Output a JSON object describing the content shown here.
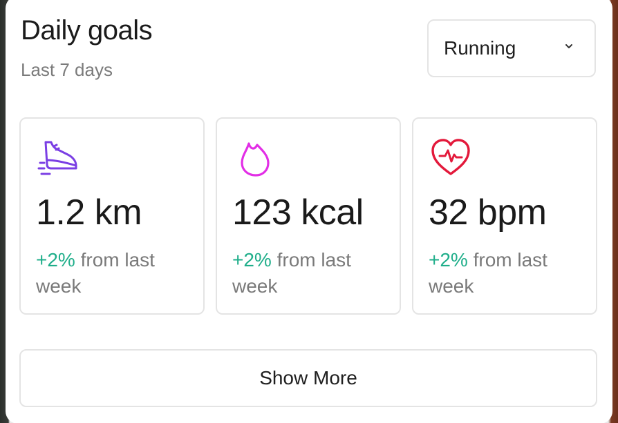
{
  "header": {
    "title": "Daily goals",
    "subtitle": "Last 7 days"
  },
  "activity_select": {
    "selected": "Running",
    "icon": "chevron-down-icon"
  },
  "stats": [
    {
      "icon": "shoe-icon",
      "icon_color": "#7b3fe4",
      "value": "1.2 km",
      "change": "+2%",
      "change_text": " from last week"
    },
    {
      "icon": "flame-icon",
      "icon_color": "#e22ee6",
      "value": "123 kcal",
      "change": "+2%",
      "change_text": " from last week"
    },
    {
      "icon": "heart-pulse-icon",
      "icon_color": "#e3193b",
      "value": "32 bpm",
      "change": "+2%",
      "change_text": " from last week"
    }
  ],
  "colors": {
    "positive_change": "#1fae8a"
  },
  "actions": {
    "show_more_label": "Show More"
  }
}
